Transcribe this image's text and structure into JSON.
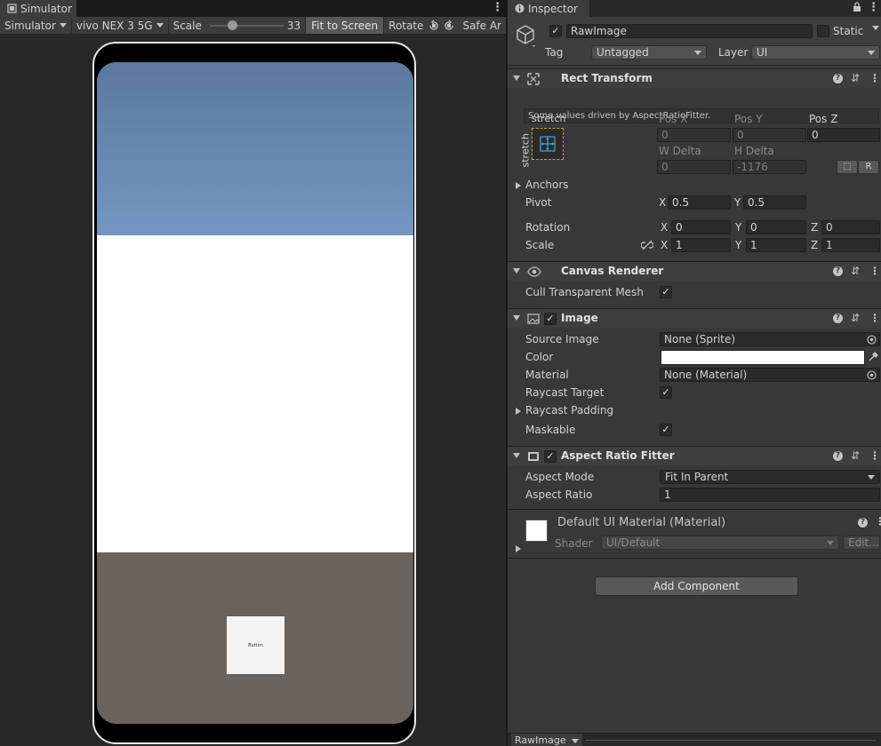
{
  "simulator": {
    "tab_title": "Simulator",
    "toolbar": {
      "mode": "Simulator",
      "device": "vivo NEX 3 5G",
      "scale_label": "Scale",
      "scale_value": "33",
      "scale_fraction": 0.3,
      "fit_to_screen": "Fit to Screen",
      "rotate": "Rotate",
      "safe_area": "Safe Ar"
    },
    "screen": {
      "button_text": "Button"
    }
  },
  "inspector": {
    "tab_title": "Inspector",
    "object": {
      "name": "RawImage",
      "active": true,
      "static_label": "Static",
      "static_checked": false,
      "tag_label": "Tag",
      "tag_value": "Untagged",
      "layer_label": "Layer",
      "layer_value": "UI"
    },
    "rect_transform": {
      "title": "Rect Transform",
      "info": "Some values driven by AspectRatioFitter.",
      "anchor_preset_top": "stretch",
      "anchor_preset_side": "stretch",
      "pos_x_label": "Pos X",
      "pos_x": "0",
      "pos_y_label": "Pos Y",
      "pos_y": "0",
      "pos_z_label": "Pos Z",
      "pos_z": "0",
      "w_delta_label": "W Delta",
      "w_delta": "0",
      "h_delta_label": "H Delta",
      "h_delta": "-1176",
      "r_button": "R",
      "anchors_label": "Anchors",
      "pivot_label": "Pivot",
      "pivot_x": "0.5",
      "pivot_y": "0.5",
      "rotation_label": "Rotation",
      "rot_x": "0",
      "rot_y": "0",
      "rot_z": "0",
      "scale_label": "Scale",
      "scale_x": "1",
      "scale_y": "1",
      "scale_z": "1",
      "axis_x": "X",
      "axis_y": "Y",
      "axis_z": "Z"
    },
    "canvas_renderer": {
      "title": "Canvas Renderer",
      "cull_label": "Cull Transparent Mesh",
      "cull_checked": true
    },
    "image": {
      "title": "Image",
      "enabled": true,
      "source_image_label": "Source Image",
      "source_image": "None (Sprite)",
      "color_label": "Color",
      "color_value": "#ffffff",
      "material_label": "Material",
      "material": "None (Material)",
      "raycast_target_label": "Raycast Target",
      "raycast_target": true,
      "raycast_padding_label": "Raycast Padding",
      "maskable_label": "Maskable",
      "maskable": true
    },
    "aspect_ratio_fitter": {
      "title": "Aspect Ratio Fitter",
      "enabled": true,
      "aspect_mode_label": "Aspect Mode",
      "aspect_mode": "Fit In Parent",
      "aspect_ratio_label": "Aspect Ratio",
      "aspect_ratio": "1"
    },
    "material_preview": {
      "title": "Default UI Material (Material)",
      "shader_label": "Shader",
      "shader": "UI/Default",
      "edit_button": "Edit..."
    },
    "add_component": "Add Component",
    "preview_label": "RawImage"
  },
  "colors": {
    "sky_top": "#5b789e",
    "ground": "#6a625c",
    "panel_bg": "#383838"
  }
}
